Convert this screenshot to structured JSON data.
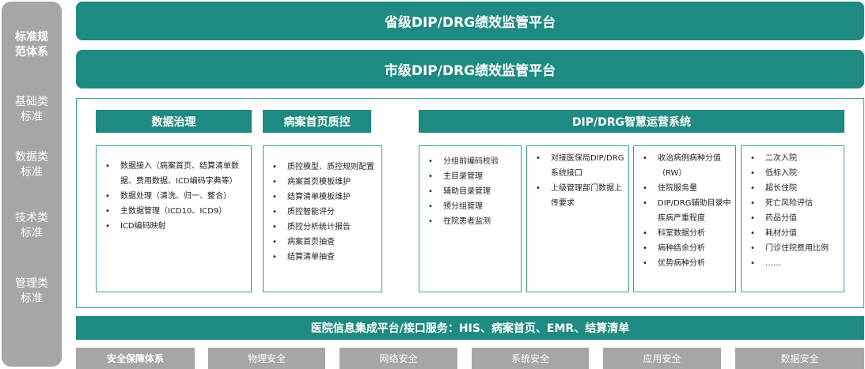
{
  "sidebar": {
    "items": [
      {
        "label": "标准规范体系"
      },
      {
        "label": "基础类标准"
      },
      {
        "label": "数据类标准"
      },
      {
        "label": "技术类标准"
      },
      {
        "label": "管理类标准"
      }
    ]
  },
  "banners": {
    "provincial": "省级DIP/DRG绩效监管平台",
    "municipal": "市级DIP/DRG绩效监管平台"
  },
  "sections": {
    "data_governance": {
      "title": "数据治理",
      "items": [
        "数据接入（病案首页、结算清单数据、费用数据、ICD编码字典等）",
        "数据处理（清洗、归一、整合）",
        "主数据管理（ICD10、ICD9）",
        "ICD编码映射"
      ]
    },
    "quality_control": {
      "title": "病案首页质控",
      "items": [
        "质控模型、质控规则配置",
        "病案首页模板维护",
        "结算清单模板维护",
        "质控智能评分",
        "质控分析统计报告",
        "病案首页抽查",
        "结算清单抽查"
      ]
    },
    "operation_system": {
      "title": "DIP/DRG智慧运营系统",
      "cards": [
        [
          "分组前编码校验",
          "主目录管理",
          "辅助目录管理",
          "预分组管理",
          "在院患者监测"
        ],
        [
          "对接医保局DIP/DRG系统接口",
          "上级管理部门数据上传要求"
        ],
        [
          "收治病例病种分值（RW）",
          "住院服务量",
          "DIP/DRG辅助目录中疾病严重程度",
          "科室数据分析",
          "病种结余分析",
          "优势病种分析"
        ],
        [
          "二次入院",
          "低标入院",
          "超长住院",
          "死亡风险评估",
          "药品分值",
          "耗材分值",
          "门诊住院费用比例",
          "……"
        ]
      ]
    }
  },
  "integration": {
    "label": "医院信息集成平台/接口服务：HIS、病案首页、EMR、结算清单"
  },
  "security": {
    "items": [
      "安全保障体系",
      "物理安全",
      "网络安全",
      "系统安全",
      "应用安全",
      "数据安全"
    ]
  }
}
